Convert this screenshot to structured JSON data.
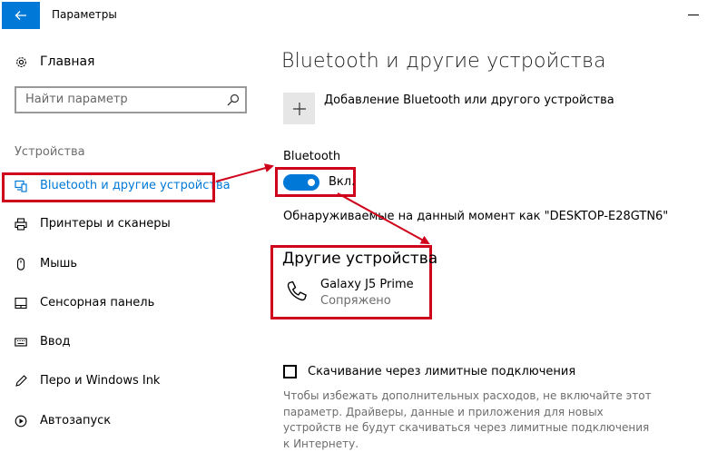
{
  "window": {
    "title": "Параметры"
  },
  "sidebar": {
    "home_label": "Главная",
    "search_placeholder": "Найти параметр",
    "section_label": "Устройства",
    "items": [
      {
        "label": "Bluetooth и другие устройства",
        "icon": "bluetooth-devices-icon",
        "active": true
      },
      {
        "label": "Принтеры и сканеры",
        "icon": "printer-icon"
      },
      {
        "label": "Мышь",
        "icon": "mouse-icon"
      },
      {
        "label": "Сенсорная панель",
        "icon": "touchpad-icon"
      },
      {
        "label": "Ввод",
        "icon": "keyboard-icon"
      },
      {
        "label": "Перо и Windows Ink",
        "icon": "pen-icon"
      },
      {
        "label": "Автозапуск",
        "icon": "autoplay-icon"
      }
    ]
  },
  "main": {
    "title": "Bluetooth и другие устройства",
    "add_device_label": "Добавление Bluetooth или другого устройства",
    "bluetooth_label": "Bluetooth",
    "toggle_state": "Вкл.",
    "discoverable_text": "Обнаруживаемые на данный момент как \"DESKTOP-E28GTN6\"",
    "other_devices_title": "Другие устройства",
    "device": {
      "name": "Galaxy J5 Prime",
      "status": "Сопряжено",
      "icon": "phone-icon"
    },
    "metered_label": "Скачивание через лимитные подключения",
    "metered_description": "Чтобы избежать дополнительных расходов, не включайте этот параметр. Драйверы, данные и приложения для новых устройств не будут скачиваться через лимитные подключения к Интернету."
  },
  "colors": {
    "accent": "#0078d7",
    "annotation": "#d0021b"
  }
}
